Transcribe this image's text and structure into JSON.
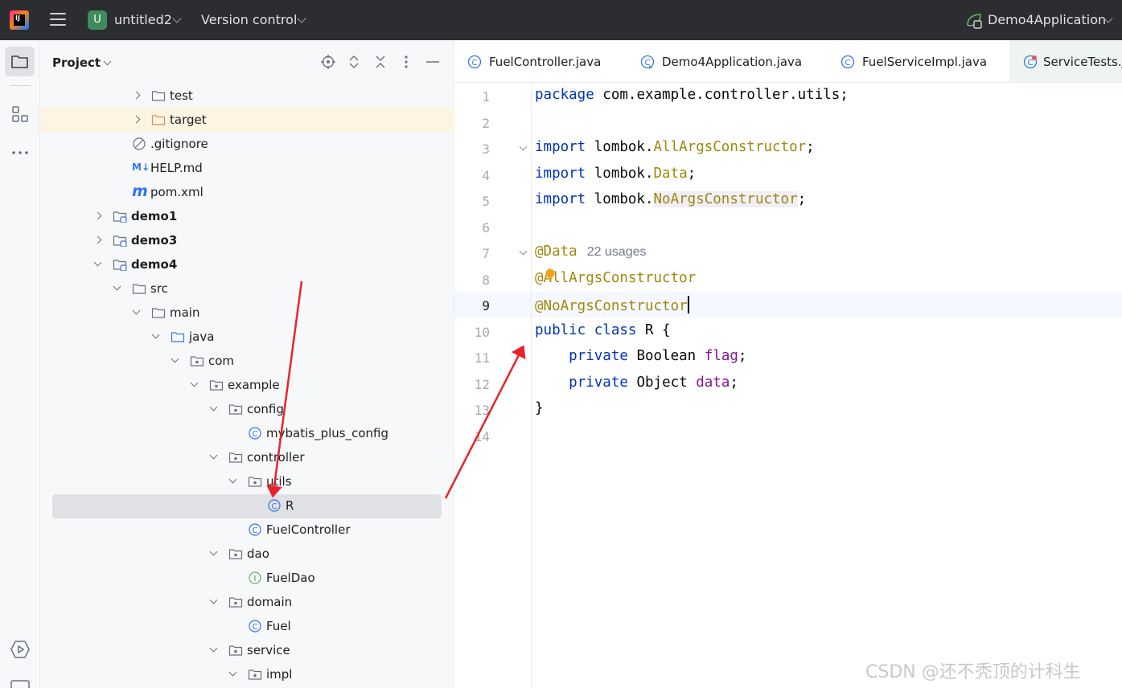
{
  "titlebar": {
    "project_badge": "U",
    "project_name": "untitled2",
    "vcs_label": "Version control",
    "run_config": "Demo4Application"
  },
  "project_panel": {
    "title": "Project",
    "tree": [
      {
        "label": "test",
        "icon": "folder-icon",
        "arrow": "closed"
      },
      {
        "label": "target",
        "icon": "folder-orange-icon",
        "arrow": "closed",
        "highlight": true
      },
      {
        "label": ".gitignore",
        "icon": "ignore-file-icon"
      },
      {
        "label": "HELP.md",
        "icon": "markdown-icon",
        "icon_text": "M↓"
      },
      {
        "label": "pom.xml",
        "icon": "maven-icon",
        "icon_text": "m"
      },
      {
        "label": "demo1",
        "icon": "module-icon",
        "arrow": "closed",
        "bold": true
      },
      {
        "label": "demo3",
        "icon": "module-icon",
        "arrow": "closed",
        "bold": true
      },
      {
        "label": "demo4",
        "icon": "module-icon",
        "arrow": "open",
        "bold": true
      },
      {
        "label": "src",
        "icon": "folder-icon",
        "arrow": "open"
      },
      {
        "label": "main",
        "icon": "folder-icon",
        "arrow": "open"
      },
      {
        "label": "java",
        "icon": "source-folder-icon",
        "arrow": "open"
      },
      {
        "label": "com",
        "icon": "package-icon",
        "arrow": "open"
      },
      {
        "label": "example",
        "icon": "package-icon",
        "arrow": "open"
      },
      {
        "label": "config",
        "icon": "package-icon",
        "arrow": "open"
      },
      {
        "label": "mybatis_plus_config",
        "icon": "class-icon"
      },
      {
        "label": "controller",
        "icon": "package-icon",
        "arrow": "open"
      },
      {
        "label": "utils",
        "icon": "package-icon",
        "arrow": "open"
      },
      {
        "label": "R",
        "icon": "class-icon",
        "selected": true
      },
      {
        "label": "FuelController",
        "icon": "class-icon"
      },
      {
        "label": "dao",
        "icon": "package-icon",
        "arrow": "open"
      },
      {
        "label": "FuelDao",
        "icon": "interface-icon"
      },
      {
        "label": "domain",
        "icon": "package-icon",
        "arrow": "open"
      },
      {
        "label": "Fuel",
        "icon": "class-icon"
      },
      {
        "label": "service",
        "icon": "package-icon",
        "arrow": "open"
      },
      {
        "label": "impl",
        "icon": "package-icon",
        "arrow": "open"
      }
    ]
  },
  "editor": {
    "tabs": [
      {
        "label": "FuelController.java",
        "icon": "class-icon"
      },
      {
        "label": "Demo4Application.java",
        "icon": "spring-class-icon"
      },
      {
        "label": "FuelServiceImpl.java",
        "icon": "class-icon"
      },
      {
        "label": "ServiceTests.java",
        "icon": "test-class-icon"
      }
    ],
    "line_numbers": [
      "1",
      "2",
      "3",
      "4",
      "5",
      "6",
      "7",
      "8",
      "9",
      "10",
      "11",
      "12",
      "13",
      "14"
    ],
    "current_line": "9",
    "code": {
      "l1_kw": "package",
      "l1_rest": " com.example.controller.utils;",
      "import_kw": "import",
      "l3_pkg": " lombok.",
      "l3_cls": "AllArgsConstructor",
      "l4_cls": "Data",
      "l5_cls": "NoArgsConstructor",
      "semicolon": ";",
      "l7_ann": "@Data",
      "l7_hint": "22 usages",
      "l8_ann": "@AllArgsConstructor",
      "l9_ann": "@NoArgsConstructor",
      "l10_kw1": "public",
      "l10_kw2": "class",
      "l10_rest": " R {",
      "private_kw": "private",
      "l11_type": " Boolean ",
      "l11_field": "flag",
      "l12_type": " Object ",
      "l12_field": "data",
      "l13": "}"
    }
  },
  "watermark": "CSDN @还不秃顶的计科生",
  "colors": {
    "titlebar_bg": "#2b2d30",
    "keyword": "#0033b3",
    "annotation": "#9e880d",
    "field": "#871094",
    "arrow_red": "#e8242b",
    "class_icon": "#3574f0"
  }
}
